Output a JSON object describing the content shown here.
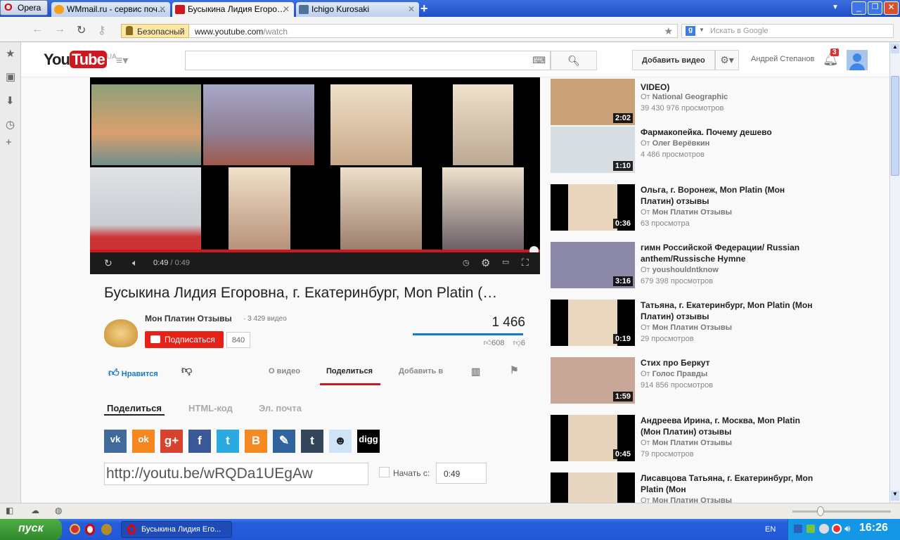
{
  "browser": {
    "menu_label": "Opera",
    "tabs": [
      {
        "label": "WMmail.ru - сервис поч…",
        "color": "#f59f1b"
      },
      {
        "label": "Бусыкина Лидия Егоро…",
        "color": "#cc181e"
      },
      {
        "label": "Ichigo Kurosaki",
        "color": "#4e729a"
      }
    ],
    "secure_label": "Безопасный",
    "url_domain": "www.youtube.com",
    "url_path": "/watch",
    "search_placeholder": "Искать в Google"
  },
  "youtube": {
    "logo_you": "You",
    "logo_tube": "Tube",
    "region": "UA",
    "upload_label": "Добавить видео",
    "user_name": "Андрей Степанов",
    "notifications": "3"
  },
  "player": {
    "time_current": "0:49",
    "time_total": "/ 0:49"
  },
  "video": {
    "title": "Бусыкина Лидия Егоровна, г. Екатеринбург, Mon Platin (…",
    "channel": "Мон Платин Отзывы",
    "channel_videos": "· 3 429 видео",
    "subscribe_label": "Подписаться",
    "subscribers": "840",
    "views": "1 466",
    "likes": "608",
    "dislikes": "6",
    "like_fraction": 0.99,
    "like_label": "Нравится",
    "actions": [
      "О видео",
      "Поделиться",
      "Добавить в"
    ]
  },
  "share": {
    "tabs": [
      "Поделиться",
      "HTML-код",
      "Эл. почта"
    ],
    "networks": [
      {
        "name": "vk",
        "glyph": "vk",
        "color": "#41699a"
      },
      {
        "name": "odnoklassniki",
        "glyph": "ok",
        "color": "#f4881f"
      },
      {
        "name": "google-plus",
        "glyph": "g+",
        "color": "#d9412f"
      },
      {
        "name": "facebook",
        "glyph": "f",
        "color": "#3b5898"
      },
      {
        "name": "twitter",
        "glyph": "t",
        "color": "#2ba9e1"
      },
      {
        "name": "blogger",
        "glyph": "B",
        "color": "#f58a23"
      },
      {
        "name": "livejournal",
        "glyph": "✎",
        "color": "#31649d"
      },
      {
        "name": "tumblr",
        "glyph": "t",
        "color": "#35465c"
      },
      {
        "name": "reddit",
        "glyph": "☻",
        "color": "#cee3f8"
      },
      {
        "name": "digg",
        "glyph": "digg",
        "color": "#000000"
      }
    ],
    "short_url": "http://youtu.be/wRQDa1UEgAw",
    "start_label": "Начать с:",
    "start_time": "0:49"
  },
  "related": [
    {
      "title": "VIDEO)",
      "by": "От",
      "channel": "National Geographic",
      "views": "39 430 976 просмотров",
      "duration": "2:02",
      "thumb": "#c9a27a"
    },
    {
      "title": "Фармакопейка. Почему дешево",
      "by": "От",
      "channel": "Олег Верёвкин",
      "views": "4 486 просмотров",
      "duration": "1:10",
      "thumb": "#d8dde2"
    },
    {
      "title": "Ольга, г. Воронеж, Mon Platin (Мон Платин) отзывы",
      "by": "От",
      "channel": "Мон Платин Отзывы",
      "views": "63 просмотра",
      "duration": "0:36",
      "thumb": "#e9d6bd"
    },
    {
      "title": "гимн Российской Федерации/ Russian anthem/Russische Hymne",
      "by": "От",
      "channel": "youshouldntknow",
      "views": "679 398 просмотров",
      "duration": "3:16",
      "thumb": "#8b88a8"
    },
    {
      "title": "Татьяна, г. Екатеринбург, Mon Platin (Мон Платин) отзывы",
      "by": "От",
      "channel": "Мон Платин Отзывы",
      "views": "29 просмотров",
      "duration": "0:19",
      "thumb": "#ead7c0"
    },
    {
      "title": "Стих про Беркут",
      "by": "От",
      "channel": "Голос Правды",
      "views": "914 856 просмотров",
      "duration": "1:59",
      "thumb": "#c7a697"
    },
    {
      "title": "Андреева Ирина, г. Москва, Mon Platin (Мон Платин) отзывы",
      "by": "От",
      "channel": "Мон Платин Отзывы",
      "views": "79 просмотров",
      "duration": "0:45",
      "thumb": "#e6d3bb"
    },
    {
      "title": "Лисавцова Татьяна, г. Екатеринбург, Mon Platin (Мон",
      "by": "От",
      "channel": "Мон Платин Отзывы",
      "views": "",
      "duration": "",
      "thumb": "#e7d6c2"
    }
  ],
  "taskbar": {
    "start_label": "пуск",
    "task": "Бусыкина Лидия Его...",
    "lang": "EN",
    "clock": "16:26"
  }
}
